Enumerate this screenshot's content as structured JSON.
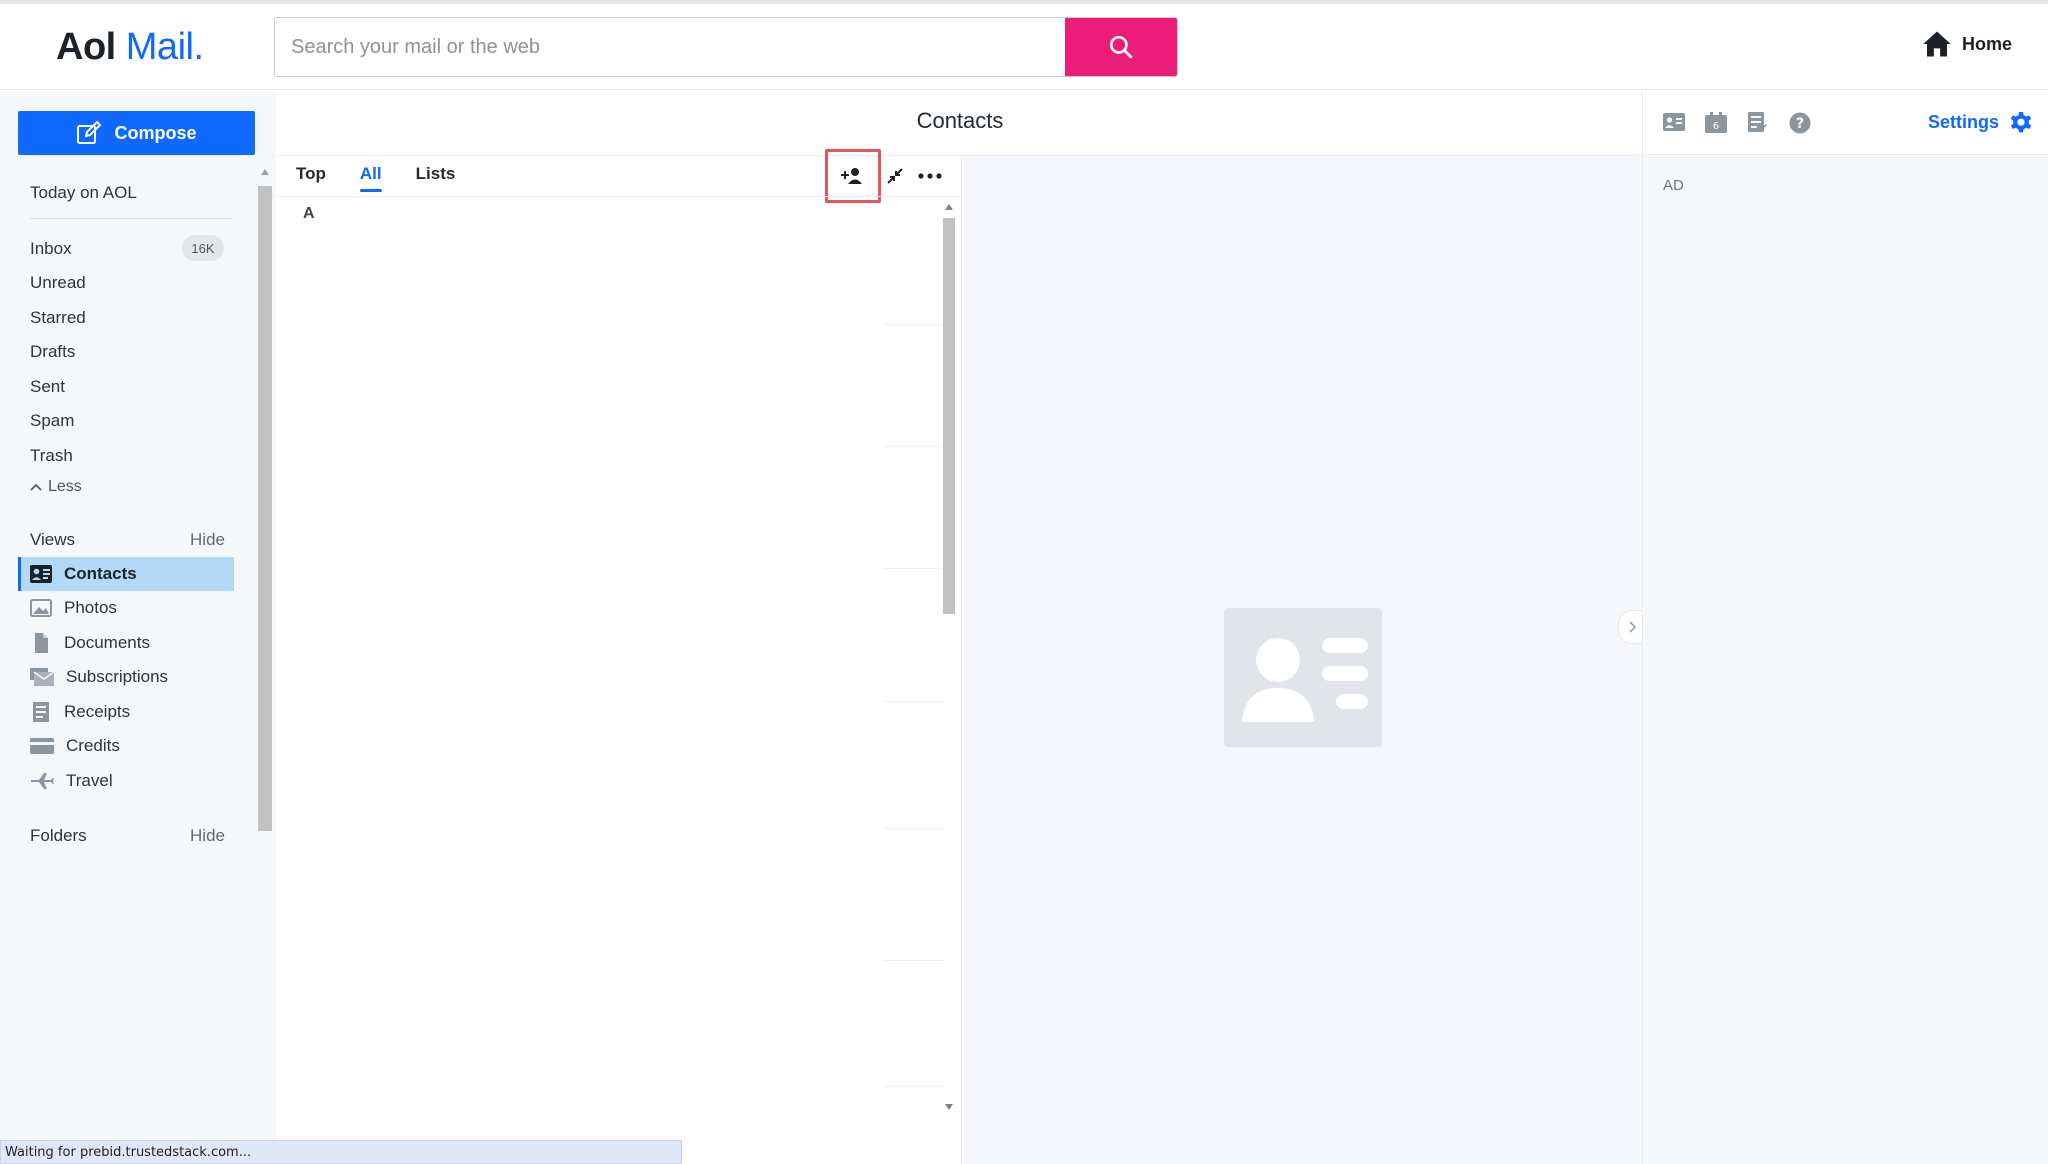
{
  "header": {
    "logo_main": "Aol",
    "logo_accent": "Mail.",
    "search_placeholder": "Search your mail or the web",
    "home_label": "Home"
  },
  "sidebar": {
    "compose_label": "Compose",
    "today_label": "Today on AOL",
    "folders": [
      {
        "label": "Inbox",
        "badge": "16K"
      },
      {
        "label": "Unread"
      },
      {
        "label": "Starred"
      },
      {
        "label": "Drafts"
      },
      {
        "label": "Sent"
      },
      {
        "label": "Spam"
      },
      {
        "label": "Trash"
      }
    ],
    "less_label": "Less",
    "views_label": "Views",
    "views_hide": "Hide",
    "views": [
      {
        "label": "Contacts",
        "icon": "contacts-icon",
        "active": true
      },
      {
        "label": "Photos",
        "icon": "photos-icon"
      },
      {
        "label": "Documents",
        "icon": "documents-icon"
      },
      {
        "label": "Subscriptions",
        "icon": "subscriptions-icon"
      },
      {
        "label": "Receipts",
        "icon": "receipts-icon"
      },
      {
        "label": "Credits",
        "icon": "credits-icon"
      },
      {
        "label": "Travel",
        "icon": "travel-icon"
      }
    ],
    "folders_label": "Folders",
    "folders_hide": "Hide"
  },
  "contacts": {
    "title": "Contacts",
    "tabs": [
      "Top",
      "All",
      "Lists"
    ],
    "active_tab": "All",
    "section_letter": "A"
  },
  "right": {
    "settings_label": "Settings",
    "ad_label": "AD"
  },
  "status": {
    "text": "Waiting for prebid.trustedstack.com..."
  },
  "colors": {
    "brand_blue": "#0f69ff",
    "search_pink": "#eb1d78",
    "highlight_red": "#e8545e",
    "active_view_bg": "#b3d9f7"
  }
}
